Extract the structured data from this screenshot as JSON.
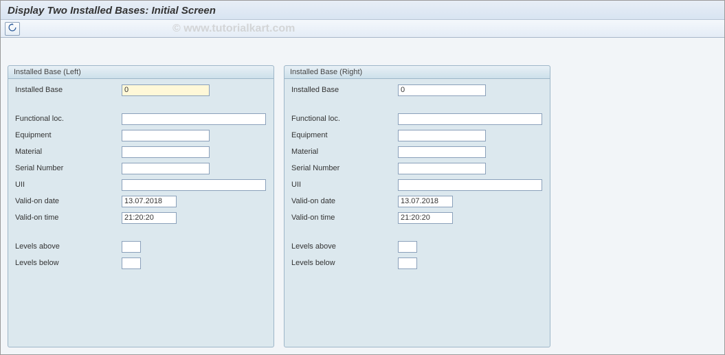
{
  "title": "Display Two Installed Bases: Initial Screen",
  "watermark": "© www.tutorialkart.com",
  "panels": {
    "left": {
      "title": "Installed Base (Left)",
      "labels": {
        "installed_base": "Installed Base",
        "functional_loc": "Functional loc.",
        "equipment": "Equipment",
        "material": "Material",
        "serial_number": "Serial Number",
        "uii": "UII",
        "valid_on_date": "Valid-on date",
        "valid_on_time": "Valid-on time",
        "levels_above": "Levels above",
        "levels_below": "Levels below"
      },
      "values": {
        "installed_base": "0",
        "functional_loc": "",
        "equipment": "",
        "material": "",
        "serial_number": "",
        "uii": "",
        "valid_on_date": "13.07.2018",
        "valid_on_time": "21:20:20",
        "levels_above": "",
        "levels_below": ""
      }
    },
    "right": {
      "title": "Installed Base (Right)",
      "labels": {
        "installed_base": "Installed Base",
        "functional_loc": "Functional loc.",
        "equipment": "Equipment",
        "material": "Material",
        "serial_number": "Serial Number",
        "uii": "UII",
        "valid_on_date": "Valid-on date",
        "valid_on_time": "Valid-on time",
        "levels_above": "Levels above",
        "levels_below": "Levels below"
      },
      "values": {
        "installed_base": "0",
        "functional_loc": "",
        "equipment": "",
        "material": "",
        "serial_number": "",
        "uii": "",
        "valid_on_date": "13.07.2018",
        "valid_on_time": "21:20:20",
        "levels_above": "",
        "levels_below": ""
      }
    }
  }
}
